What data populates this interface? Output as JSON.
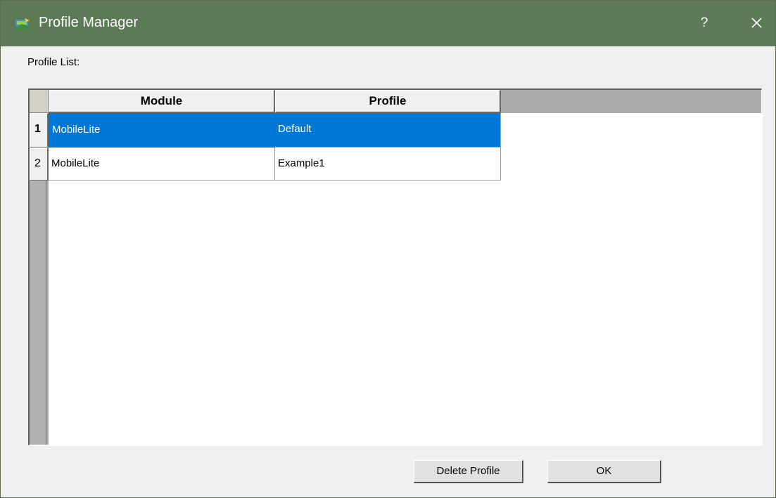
{
  "window": {
    "title": "Profile Manager",
    "help_label": "?",
    "icons": {
      "app": "profile-manager-app-icon",
      "close": "close-icon"
    }
  },
  "profile_list_label": "Profile List:",
  "grid": {
    "columns": [
      "Module",
      "Profile"
    ],
    "rows": [
      {
        "row_number": "1",
        "module": "MobileLite",
        "profile": "Default",
        "selected": true
      },
      {
        "row_number": "2",
        "module": "MobileLite",
        "profile": "Example1",
        "selected": false
      }
    ]
  },
  "buttons": {
    "delete_profile": "Delete Profile",
    "ok": "OK"
  },
  "colors": {
    "titlebar": "#5d7a57",
    "selection": "#0078d7"
  }
}
